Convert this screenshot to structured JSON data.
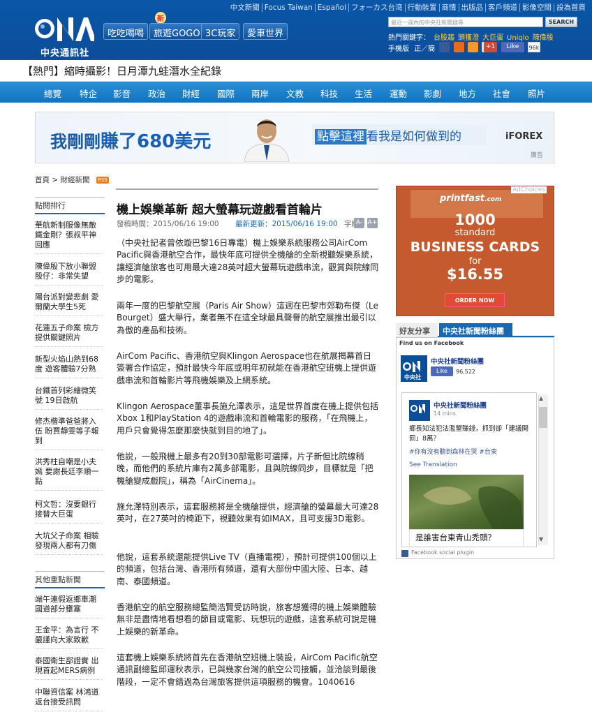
{
  "header": {
    "top_links": [
      "中文新聞",
      "Focus Taiwan",
      "Español",
      "フォーカス台湾",
      "行動裝置",
      "商情",
      "出版品",
      "客戶頻道",
      "影像空間",
      "設為首頁"
    ],
    "logo_text": "中央通訊社",
    "logo_mark": "CNA",
    "channel_tabs": [
      "吃吃喝喝",
      "旅遊GOGO",
      "3C玩家",
      "愛車世界"
    ],
    "new_badge": "新",
    "search_placeholder": "最近一週內的中央社新聞搜尋",
    "search_button": "SEARCH",
    "hot_label": "熱門關鍵字：",
    "hot_keywords": [
      "台股趨",
      "頭獲澄",
      "大巨蛋",
      "Uniqlo",
      "陳偉殷"
    ],
    "mobile_label": "手機版",
    "mobile_value": "正／簡",
    "gplus_count": "+1",
    "like_label": "Like",
    "like_count": "96k"
  },
  "ticker": "【熱門】縮時攝影！日月潭九蛙潛水全紀錄",
  "nav": [
    "總覽",
    "特企",
    "影音",
    "政治",
    "財經",
    "國際",
    "兩岸",
    "文教",
    "科技",
    "生活",
    "運動",
    "影劇",
    "地方",
    "社會",
    "照片"
  ],
  "banner_ad": {
    "headline_pre": "我剛剛",
    "headline_big": "賺了680美元",
    "cta_highlight": "點擊這裡",
    "cta_rest": "看我是如何做到的",
    "brand": "iFOREX",
    "ad_label": "廣告"
  },
  "breadcrumb": {
    "home": "首頁",
    "sep": ">",
    "section": "財經新聞",
    "rss": "RSS"
  },
  "sidebar": {
    "popular_title": "點閱排行",
    "popular_items": [
      "華航新制服像無敵鐵金剛？張叔平神回應",
      "陳偉殷下放小聯盟 殷仔：非常失望",
      "陽台派對變悲劇 愛爾蘭大學生5死",
      "花蓮五子命案 檢方提供關鍵照片",
      "新型火焰山熱到68度 遊客體驗7分熟",
      "台鐵首列彩繪微笑號 19日啟航",
      "修杰楷準爸爸將入伍 盼賈靜雯等子報到",
      "洪秀柱自嘲是小夫嫣 要謝長廷李順一點",
      "柯文哲：沒要銀行接替大巨蛋",
      "大坑父子命案 相驗發現兩人都有刀傷"
    ],
    "other_title": "其他重點新聞",
    "other_items": [
      "端午連假返鄉車潮 國道部分壅塞",
      "王金平：為言行 不嚴謹向大家致歉",
      "泰國衛生部證實 出現首起MERS病例",
      "中聯資信案 林鴻道返台接受訊問"
    ]
  },
  "article": {
    "title": "機上娛樂革新 超大螢幕玩遊戲看首輪片",
    "sent_label": "發稿時間：",
    "sent_time": "2015/06/16 19:00",
    "updated_label": "最新更新：",
    "updated_time": "2015/06/16 19:00",
    "font_label": "字級：",
    "font_small": "A-",
    "font_big": "A+",
    "paragraphs": [
      "（中央社記者曾依璇巴黎16日專電）機上娛樂系統服務公司AirCom Pacific與香港航空合作，最快年底可提供全機艙的全新視聽娛樂系統，讓經濟艙旅客也可用最大達28英吋超大螢幕玩遊戲串流，觀賞與院線同步的電影。",
      "兩年一度的巴黎航空展（Paris Air Show）這週在巴黎市郊勒布傑（Le Bourget）盛大舉行，業者無不在這全球最具聲譽的航空展推出最引以為傲的產品和技術。",
      "AirCom Pacific、香港航空與Klingon Aerospace也在航展揭幕首日簽署合作協定，預計最快今年底或明年初就能在香港航空班機上提供遊戲串流和首輪影片等飛機娛樂及上網系統。",
      "Klingon Aerospace董事長施允澤表示，這是世界首度在機上提供包括Xbox 1和PlayStation 4的遊戲串流和首輪電影的服務，「在飛機上，用戶只會覺得怎麼那麼快就到目的地了」。",
      "他說，一般飛機上最多有20到30部電影可選擇，片子新但比院線稍晚，而他們的系統片庫有2萬多部電影，且與院線同步，目標就是「把機艙變成戲院」，稱為「AirCinema」。",
      "施允澤特別表示，這套服務將是全機艙提供，經濟艙的螢幕最大可達28英吋，在27英吋的椅距下，視聽效果有如IMAX，且可支援3D電影。",
      "他說，這套系統還能提供Live TV（直播電視），預計可提供100個以上的頻道，包括台灣、香港所有頻道，還有大部份中國大陸、日本、越南、泰國頻道。",
      "香港航空的航空服務總監簡浩賢受訪時說，旅客想獲得的機上娛樂體驗無非是盡情地看想看的節目或電影、玩想玩的遊戲，這套系統可說是機上娛樂的新革命。",
      "這套機上娛樂系統將首先在香港航空班機上裝設，AirCom Pacific航空通訊副總監邱運秋表示，已與幾家台灣的航空公司接觸，並洽談到最後階段，一定不會錯過為台灣旅客提供這項服務的機會。1040616"
    ]
  },
  "right_ad": {
    "tag": "AdChoices",
    "brand": "printfast",
    "brand_suffix": ".com",
    "number": "1000",
    "standard": "standard",
    "product": "BUSINESS CARDS",
    "for": "for",
    "price": "$16.55",
    "button": "ORDER NOW"
  },
  "facebook": {
    "tab_friends": "好友分享",
    "tab_fans": "中央社新聞粉絲團",
    "find_us": "Find us on Facebook",
    "page_name": "中央社新聞粉絲團",
    "logo_caption": "中央社",
    "like_label": "Like",
    "like_count": "96,522",
    "post_page": "中央社新聞粉絲團",
    "post_time": "14 mins",
    "post_text": "鄉長知法犯法濫墾賺錢，抓到卻「建議開罰」8萬？",
    "post_tags": "#你有沒有聽到森林在哭 #台東",
    "see_translation": "See Translation",
    "photo_caption": "是誰害台東青山禿頭？",
    "plugin_label": "Facebook social plugin"
  }
}
